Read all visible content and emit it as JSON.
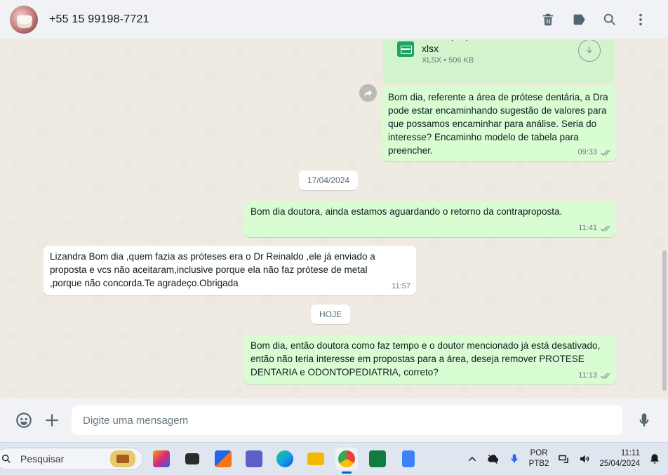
{
  "header": {
    "contact": "+55 15 99198-7721",
    "icons": [
      "delete-icon",
      "label-icon",
      "search-icon",
      "menu-icon"
    ]
  },
  "file": {
    "name": "Contraproposta Protese Dentaria. xlsx",
    "meta": "XLSX • 506 KB"
  },
  "messages": [
    {
      "text": "Bom dia, referente a área de prótese dentária, a Dra pode estar encaminhando sugestão de valores para que possamos encaminhar para análise. Seria do interesse? Encaminho modelo de tabela para preencher.",
      "time": "09:33"
    },
    {
      "date": "17/04/2024"
    },
    {
      "text": "Bom dia doutora, ainda estamos aguardando o retorno da contraproposta.",
      "time": "11:41"
    },
    {
      "text": "Lizandra Bom dia ,quem fazia as próteses era o Dr Reinaldo ,ele já enviado a proposta e vcs não aceitaram,inclusive porque ela não faz prótese de metal ,porque não concorda.Te agradeço.Obrigada",
      "time": "11:57"
    },
    {
      "date": "HOJE"
    },
    {
      "text": "Bom dia, então doutora como faz tempo e o doutor mencionado já está desativado, então não teria interesse em propostas para a área, deseja remover PROTESE DENTARIA e ODONTOPEDIATRIA, correto?",
      "time": "11:13"
    }
  ],
  "composer": {
    "placeholder": "Digite uma mensagem"
  },
  "taskbar": {
    "search": "Pesquisar",
    "lang_line1": "POR",
    "lang_line2": "PTB2",
    "time": "11:11",
    "date": "25/04/2024"
  },
  "colors": {
    "outgoing": "#d9fdd3",
    "incoming": "#ffffff",
    "chat_bg": "#efeae2"
  }
}
